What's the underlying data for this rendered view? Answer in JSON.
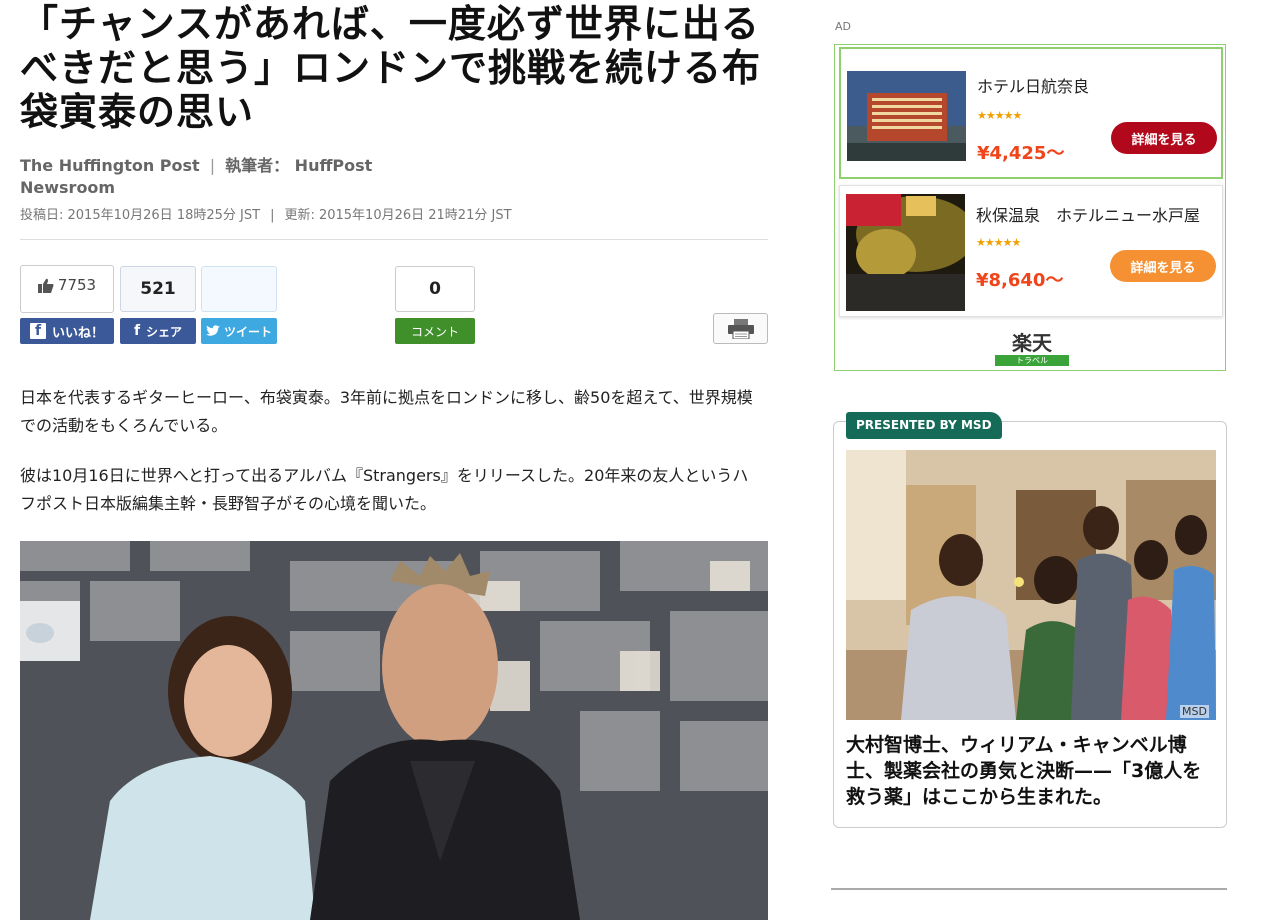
{
  "article": {
    "title": "「チャンスがあれば、一度必ず世界に出るべきだと思う」ロンドンで挑戦を続ける布袋寅泰の思い",
    "source": "The Huffington Post",
    "author_label": "執筆者：",
    "author_name": "HuffPost Newsroom",
    "posted": "投稿日: 2015年10月26日 18時25分 JST",
    "updated": "更新: 2015年10月26日 21時21分 JST",
    "paragraphs": [
      "日本を代表するギターヒーロー、布袋寅泰。3年前に拠点をロンドンに移し、齢50を超えて、世界規模での活動をもくろんでいる。",
      "彼は10月16日に世界へと打って出るアルバム『Strangers』をリリースした。20年来の友人というハフポスト日本版編集主幹・長野智子がその心境を聞いた。"
    ]
  },
  "social": {
    "like_count": "7753",
    "share_count": "521",
    "tweet_count": "",
    "comment_count": "0",
    "like_label": "いいね！",
    "share_label": "シェア",
    "tweet_label": "ツイート",
    "comment_label": "コメント"
  },
  "ad": {
    "label": "AD",
    "items": [
      {
        "name": "ホテル日航奈良",
        "rating": 4.5,
        "price": "¥4,425〜",
        "button": "詳細を見る"
      },
      {
        "name": "秋保温泉　ホテルニュー水戸屋",
        "rating": 4.5,
        "price": "¥8,640〜",
        "button": "詳細を見る"
      }
    ],
    "brand": "楽天",
    "brand_sub": "トラベル"
  },
  "sponsored": {
    "badge": "PRESENTED BY MSD",
    "credit": "MSD",
    "headline": "大村智博士、ウィリアム・キャンベル博士、製薬会社の勇気と決断——「3億人を救う薬」はここから生まれた。"
  },
  "colors": {
    "facebook": "#3b5998",
    "twitter": "#3ea8e0",
    "comment": "#3f8f2a",
    "ad_border": "#8fcf6e",
    "price": "#f0441a",
    "badge": "#156b58"
  }
}
